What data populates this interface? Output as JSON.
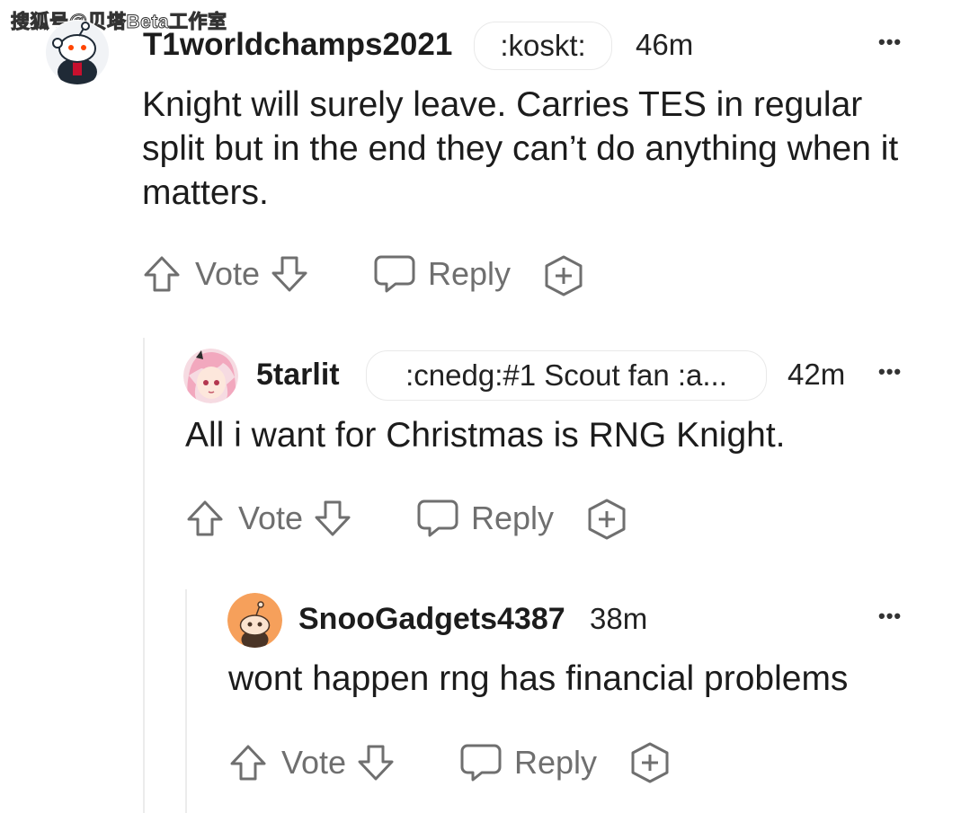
{
  "watermark": "搜狐号@贝塔Beta工作室",
  "comments": [
    {
      "username": "T1worldchamps2021",
      "flair": ":koskt:",
      "time": "46m",
      "more": "•••",
      "body": "Knight will surely leave. Carries TES in regular split but in the end they can’t do anything when it matters.",
      "vote_label": "Vote",
      "reply_label": "Reply"
    },
    {
      "username": "5tarlit",
      "flair": ":cnedg:#1 Scout fan :a...",
      "time": "42m",
      "more": "•••",
      "body": "All i want for Christmas is RNG Knight.",
      "vote_label": "Vote",
      "reply_label": "Reply"
    },
    {
      "username": "SnooGadgets4387",
      "time": "38m",
      "more": "•••",
      "body": "wont happen rng has financial problems",
      "vote_label": "Vote",
      "reply_label": "Reply"
    }
  ],
  "colors": {
    "text": "#1c1c1c",
    "action": "#6f6f6f",
    "thread_line": "#ececec",
    "flair_border": "#e9e9e9",
    "snoo_orange": "#f6a05b"
  },
  "icons": [
    "upvote-icon",
    "downvote-icon",
    "reply-icon",
    "award-icon",
    "more-icon",
    "avatar-snoo"
  ]
}
